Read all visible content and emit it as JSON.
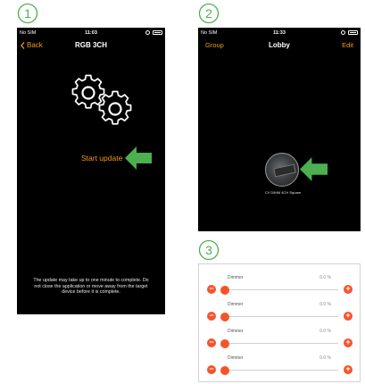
{
  "steps": {
    "one": "1",
    "two": "2",
    "three": "3"
  },
  "screen1": {
    "status": {
      "carrier": "No SIM",
      "time": "11:03"
    },
    "nav": {
      "back_label": "Back",
      "title": "RGB 3CH"
    },
    "start_update_label": "Start update",
    "update_note": "The update may take up to one minute to complete. Do not close the application or move away from the target device before it is complete."
  },
  "screen2": {
    "status": {
      "carrier": "No SIM",
      "time": "11:33"
    },
    "nav": {
      "left_label": "Group",
      "title": "Lobby",
      "right_label": "Edit"
    },
    "device_name": "CV DIMM 4CH Square"
  },
  "screen3": {
    "rows": [
      {
        "label": "Dimmer",
        "value": "0.0 %",
        "level": 0
      },
      {
        "label": "Dimmer",
        "value": "0.0 %",
        "level": 0
      },
      {
        "label": "Dimmer",
        "value": "0.0 %",
        "level": 0
      },
      {
        "label": "Dimmer",
        "value": "0.0 %",
        "level": 0
      }
    ]
  },
  "colors": {
    "accent_orange": "#f19a1a",
    "arrow_green": "#4caf50",
    "slider_red": "#f5542b",
    "step_number_green": "#4caf50"
  }
}
